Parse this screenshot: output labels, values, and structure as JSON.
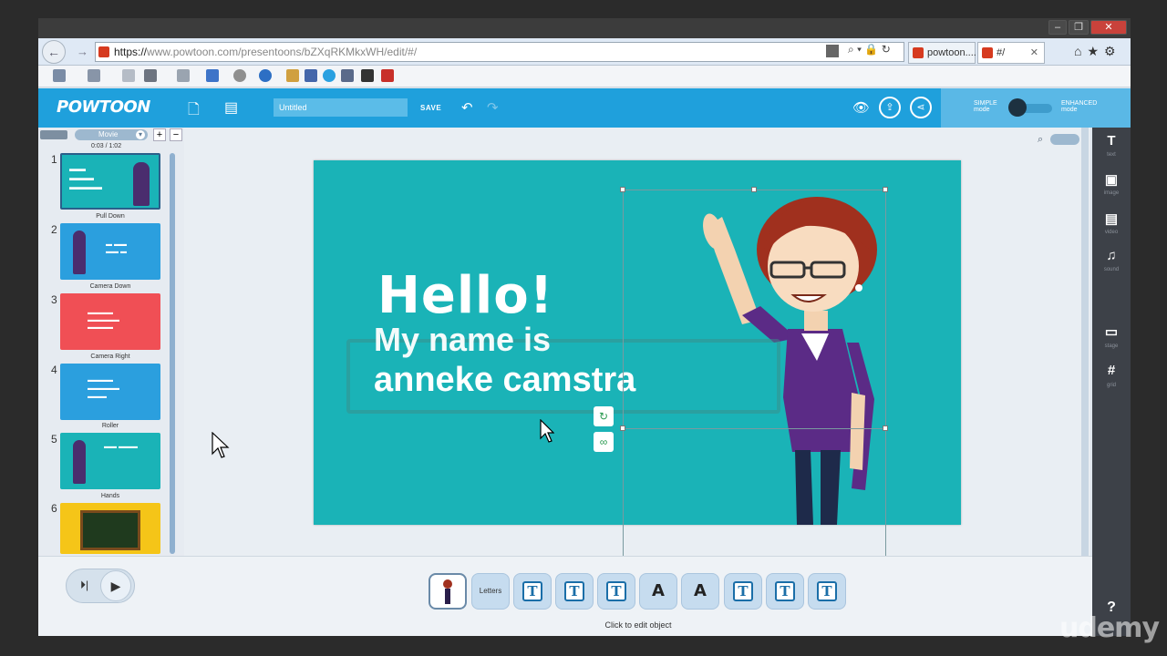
{
  "browser": {
    "url_secure": "https://",
    "url_domain": "www.powtoon.com",
    "url_path": "/presentoons/bZXqRKMkxWH/edit/#/",
    "tabs": [
      {
        "label": "powtoon...."
      },
      {
        "label": "#/"
      }
    ],
    "window_buttons": [
      "–",
      "❐",
      "✕"
    ]
  },
  "header": {
    "logo": "POWTOON",
    "title_value": "Untitled",
    "save_label": "SAVE",
    "mode_simple": "SIMPLE mode",
    "mode_enhanced": "ENHANCED mode"
  },
  "left_panel": {
    "movie_label": "Movie",
    "time": "0:03 / 1:02",
    "slides": [
      {
        "num": "1",
        "transition": "Pull Down",
        "color": "#1ab3b7"
      },
      {
        "num": "2",
        "transition": "Camera Down",
        "color": "#2b9fde"
      },
      {
        "num": "3",
        "transition": "Camera Right",
        "color": "#f04f55"
      },
      {
        "num": "4",
        "transition": "Roller",
        "color": "#2b9fde"
      },
      {
        "num": "5",
        "transition": "Hands",
        "color": "#1ab3b7"
      },
      {
        "num": "6",
        "transition": "",
        "color": "#f5c518"
      }
    ]
  },
  "canvas": {
    "hello": "Hello!",
    "line1": "My name is",
    "line2": "anneke camstra",
    "bg_color": "#1ab3b7"
  },
  "right_toolbar": [
    {
      "icon": "T",
      "label": "text"
    },
    {
      "icon": "▣",
      "label": "image"
    },
    {
      "icon": "▤",
      "label": "video"
    },
    {
      "icon": "♫",
      "label": "sound"
    },
    {
      "icon": "▭",
      "label": "stage"
    },
    {
      "icon": "#",
      "label": "grid"
    }
  ],
  "bottom": {
    "layers": [
      "char",
      "Letters",
      "T",
      "T",
      "T",
      "A",
      "A",
      "T",
      "T",
      "T"
    ],
    "hint": "Click to edit object",
    "help": "?"
  },
  "watermark": "udemy"
}
